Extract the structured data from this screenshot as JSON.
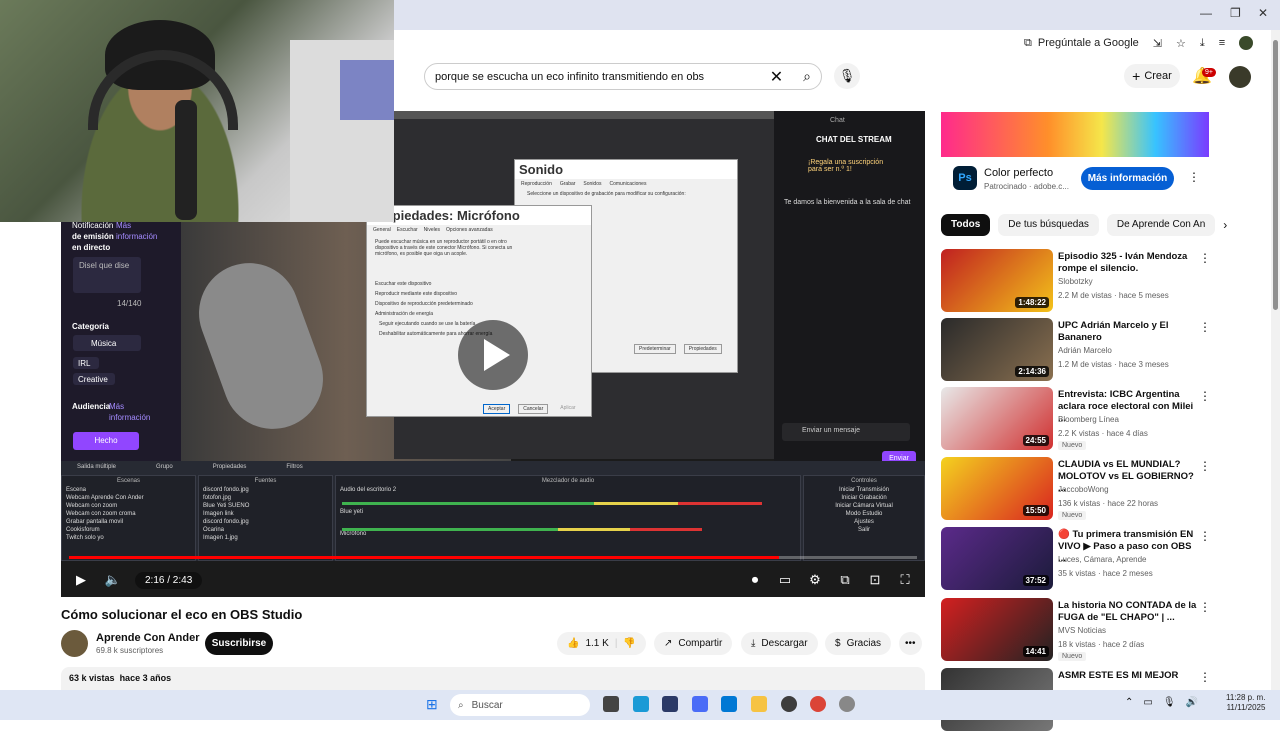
{
  "browser": {
    "ask_google": "Pregúntale a Google",
    "window_controls": [
      "—",
      "❐",
      "✕"
    ]
  },
  "search": {
    "query": "porque se escucha un eco infinito transmitiendo en obs"
  },
  "header": {
    "create_label": "Crear",
    "notifications_badge": "9+"
  },
  "player": {
    "time": "2:16 / 2:43",
    "progress": 0.837,
    "obs": {
      "notif_label": "Notificación",
      "notif_more": "Más",
      "emission_label": "de emisión",
      "emission_info": "información",
      "live_label": "en directo",
      "say_placeholder": "Disel que dise",
      "counter": "14/140",
      "category_label": "Categoría",
      "music_tag": "Música",
      "irl_tag": "IRL",
      "creative_tag": "Creative",
      "audience_label": "Audiencia",
      "audience_more": "Más",
      "audience_info": "información",
      "done_button": "Hecho",
      "chat_label": "Chat",
      "chat_header": "CHAT DEL STREAM",
      "chat_gift": "¡Regala una suscripción para ser n.º 1!",
      "chat_welcome": "Te damos la bienvenida a la sala de chat",
      "chat_send_placeholder": "Enviar un mensaje",
      "chat_send_button": "Enviar",
      "dialog_title": "Propiedades: Micrófono",
      "dialog_tabs": [
        "General",
        "Escuchar",
        "Niveles",
        "Opciones avanzadas"
      ],
      "dialog_text": "Puede escuchar música en un reproductor portátil o en otro dispositivo a través de este conector Micrófono. Si conecta un micrófono, es posible que oiga un acople.",
      "dialog_check": "Escuchar este dispositivo",
      "dialog_playback": "Reproducir mediante este dispositivo",
      "dialog_default": "Dispositivo de reproducción predeterminado",
      "dialog_power": "Administración de energía",
      "dialog_opt1": "Seguir ejecutando cuando se use la batería",
      "dialog_opt2": "Deshabilitar automáticamente para ahorrar energía",
      "dialog_buttons": [
        "Aceptar",
        "Cancelar",
        "Aplicar"
      ],
      "sound_title": "Sonido",
      "sound_tabs": [
        "Reproducción",
        "Grabar",
        "Sonidos",
        "Comunicaciones"
      ],
      "sound_hint": "Seleccione un dispositivo de grabación para modificar su configuración:",
      "sound_buttons": [
        "Predeterminar",
        "Propiedades"
      ],
      "docks": {
        "scenes": "Escenas",
        "sources": "Fuentes",
        "mixer": "Mezclador de audio",
        "controls": "Controles",
        "scene_list": [
          "Escena",
          "Webcam Aprende Con Ander",
          "Webcam con zoom",
          "Webcam con zoom croma",
          "Grabar pantalla movil",
          "Cookisforum",
          "Twitch solo yo"
        ],
        "source_list": [
          "discord fondo.jpg",
          "fotofon.jpg",
          "Blue Yeti SUENO",
          "Imagen link",
          "discord fondo.jpg",
          "Ocarina",
          "Imagen 1.jpg"
        ],
        "control_list": [
          "Iniciar Transmisión",
          "Iniciar Grabación",
          "Iniciar Cámara Virtual",
          "Modo Estudio",
          "Ajustes",
          "Salir"
        ],
        "mixer_tracks": [
          "Audio del escritorio 2",
          "Blue yeti",
          "Micrófono"
        ],
        "bar_items": [
          "Salida múltiple",
          "Grupo",
          "Propiedades",
          "Filtros"
        ]
      }
    }
  },
  "video": {
    "title": "Cómo solucionar el eco en OBS Studio",
    "channel": "Aprende Con Ander",
    "subscribers": "69.8 k suscriptores",
    "subscribe": "Suscribirse",
    "likes": "1.1 K",
    "share": "Compartir",
    "download": "Descargar",
    "thanks": "Gracias",
    "views": "63 k vistas",
    "age": "hace 3 años"
  },
  "ad": {
    "title": "Color perfecto",
    "sponsored": "Patrocinado · adobe.c...",
    "button": "Más información",
    "logo": "Ps"
  },
  "chips": [
    "Todos",
    "De tus búsquedas",
    "De Aprende Con An"
  ],
  "recommendations": [
    {
      "title": "Episodio 325 - Iván Mendoza rompe el silencio.",
      "channel": "Slobotzky",
      "meta": "2.2 M de vistas · hace 5 meses",
      "duration": "1:48:22",
      "color1": "#c02020",
      "color2": "#f3c21a"
    },
    {
      "title": "UPC Adrián Marcelo y El Bananero",
      "channel": "Adrián Marcelo",
      "meta": "1.2 M de vistas · hace 3 meses",
      "duration": "2:14:36",
      "color1": "#2a2a2a",
      "color2": "#8a7050"
    },
    {
      "title": "Entrevista: ICBC Argentina aclara roce electoral con Milei ...",
      "channel": "Bloomberg Línea",
      "meta": "2.2 K vistas · hace 4 días",
      "duration": "24:55",
      "badge": "Nuevo",
      "color1": "#e8e8e8",
      "color2": "#d03030"
    },
    {
      "title": "CLAUDIA vs EL MUNDIAL? MOLOTOV vs EL GOBIERNO? ...",
      "channel": "JaccoboWong",
      "meta": "136 k vistas · hace 22 horas",
      "duration": "15:50",
      "badge": "Nuevo",
      "color1": "#f4d21f",
      "color2": "#d9241f"
    },
    {
      "title": "🔴 Tu primera transmisión EN VIVO ▶ Paso a paso con OBS ...",
      "channel": "Luces, Cámara, Aprende",
      "meta": "35 k vistas · hace 2 meses",
      "duration": "37:52",
      "color1": "#5b2a8a",
      "color2": "#1b1b3a"
    },
    {
      "title": "La historia NO CONTADA de la FUGA de \"EL CHAPO\" | ...",
      "channel": "MVS Noticias",
      "meta": "18 k vistas · hace 2 días",
      "duration": "14:41",
      "badge": "Nuevo",
      "color1": "#d32020",
      "color2": "#222"
    },
    {
      "title": "ASMR ESTE ES MI MEJOR",
      "channel": "",
      "meta": "",
      "duration": "",
      "color1": "#333",
      "color2": "#777"
    }
  ],
  "taskbar": {
    "search": "Buscar",
    "time": "11:28 p. m.",
    "date": "11/11/2025"
  },
  "colors": {
    "accent_red": "#ff0000",
    "twitch_purple": "#9146ff",
    "blue_button": "#065fd4"
  }
}
